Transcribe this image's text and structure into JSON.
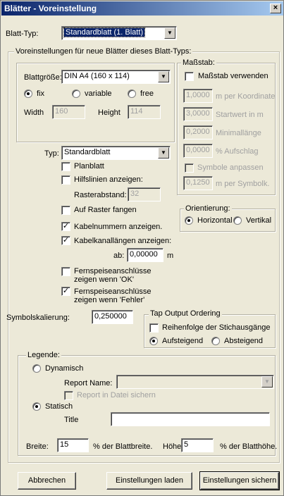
{
  "window": {
    "title": "Blätter - Voreinstellung",
    "close_symbol": "×"
  },
  "blatt_typ": {
    "label": "Blatt-Typ:",
    "value": "Standardblatt (1. Blatt)"
  },
  "group_main": {
    "label": "Voreinstellungen für neue Blätter dieses Blatt-Typs:"
  },
  "blattgroesse": {
    "label": "Blattgröße:",
    "value": "DIN A4 (160 x 114)"
  },
  "size_mode": {
    "fix": "fix",
    "variable": "variable",
    "free": "free",
    "selected": "fix"
  },
  "width": {
    "label": "Width",
    "value": "160"
  },
  "height": {
    "label": "Height",
    "value": "114"
  },
  "massstab": {
    "group_label": "Maßstab:",
    "use_label": "Maßstab verwenden",
    "use_checked": false,
    "per_coord": {
      "value": "1,0000",
      "label": "m per Koordinate"
    },
    "startwert": {
      "value": "3,0000",
      "label": "Startwert in m"
    },
    "minimal": {
      "value": "0,2000",
      "label": "Minimallänge"
    },
    "aufschlag": {
      "value": "0,0000",
      "label": "% Aufschlag"
    },
    "symbole_label": "Symbole anpassen",
    "symbole_checked": false,
    "per_symbol": {
      "value": "0,1250",
      "label": "m per Symbolk."
    }
  },
  "typ": {
    "label": "Typ:",
    "value": "Standardblatt"
  },
  "options": {
    "planblatt": {
      "label": "Planblatt",
      "checked": false
    },
    "hilfslinien": {
      "label": "Hilfslinien anzeigen:",
      "checked": false
    },
    "rasterabstand": {
      "label": "Rasterabstand:",
      "value": "32"
    },
    "auf_raster": {
      "label": "Auf Raster fangen",
      "checked": false
    },
    "kabelnummern": {
      "label": "Kabelnummern anzeigen.",
      "checked": true
    },
    "kabelkanal": {
      "label": "Kabelkanallängen anzeigen:",
      "checked": true
    },
    "ab": {
      "label": "ab:",
      "value": "0,00000",
      "unit": "m"
    },
    "fernspeise_ok": {
      "label_line1": "Fernspeiseanschlüsse",
      "label_line2": "zeigen wenn 'OK'",
      "checked": false
    },
    "fernspeise_fehler": {
      "label_line1": "Fernspeiseanschlüsse",
      "label_line2": "zeigen wenn 'Fehler'",
      "checked": true
    }
  },
  "orientierung": {
    "group_label": "Orientierung:",
    "horizontal": "Horizontal",
    "vertikal": "Vertikal",
    "selected": "Horizontal"
  },
  "symbolskalierung": {
    "label": "Symbolskalierung:",
    "value": "0,250000"
  },
  "tap_output": {
    "group_label": "Tap Output Ordering",
    "reihenfolge_label": "Reihenfolge der Stichausgänge",
    "reihenfolge_checked": false,
    "aufsteigend": "Aufsteigend",
    "absteigend": "Absteigend",
    "selected": "Aufsteigend"
  },
  "legende": {
    "group_label": "Legende:",
    "dynamisch": "Dynamisch",
    "report_name_label": "Report Name:",
    "report_name_value": "",
    "report_sichern_label": "Report in Datei sichern",
    "statisch": "Statisch",
    "title_label": "Title",
    "title_value": "",
    "selected": "Statisch",
    "breite_label": "Breite:",
    "breite_value": "15",
    "breite_suffix": "% der Blattbreite.",
    "hoehe_label": "Höhe:",
    "hoehe_value": "5",
    "hoehe_suffix": "% der Blatthöhe."
  },
  "buttons": {
    "abbrechen": "Abbrechen",
    "laden": "Einstellungen laden",
    "sichern": "Einstellungen sichern"
  }
}
